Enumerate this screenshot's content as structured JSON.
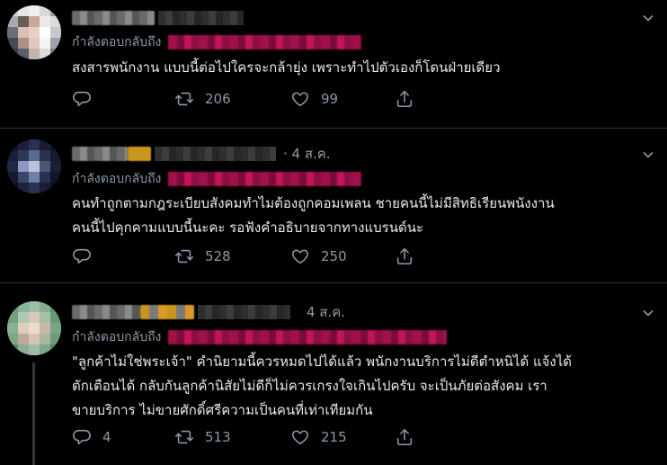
{
  "colors": {
    "background": "#000000",
    "text": "#e7e9ea",
    "muted": "#8b98a5",
    "mention": "#c21458"
  },
  "tweets": [
    {
      "reply_prefix": "กำลังตอบกลับถึง",
      "text": "สงสารพนักงาน แบบนี้ต่อไปใครจะกล้ายุ่ง เพราะทำไปตัวเองก็โดนฝ่ายเดียว",
      "replies": "",
      "retweets": "206",
      "likes": "99"
    },
    {
      "date": "· 4 ส.ค.",
      "reply_prefix": "กำลังตอบกลับถึง",
      "text": "คนทำถูกตามกฎระเบียบสังคมทำไมต้องถูกคอมเพลน ชายคนนี้ไม่มีสิทธิเรียนพนังงาน\nคนนี้ไปคุกคามแบบนี้นะคะ รอฟังคำอธิบายจากทางแบรนด์นะ",
      "replies": "",
      "retweets": "528",
      "likes": "250"
    },
    {
      "date": "4 ส.ค.",
      "reply_prefix": "กำลังตอบกลับถึง",
      "text": "\"ลูกค้าไม่ใช่พระเจ้า\" คำนิยามนี้ควรหมดไปได้แล้ว พนักงานบริการไม่ดีตำหนิได้ แจ้งได้\nตักเตือนได้ กลับกันลูกค้านิสัยไม่ดีก็ไม่ควรเกรงใจเกินไปครับ จะเป็นภัยต่อสังคม เรา\nขายบริการ ไม่ขายศักดิ์ศรีความเป็นคนที่เท่าเทียมกัน",
      "replies": "4",
      "retweets": "513",
      "likes": "215"
    }
  ]
}
